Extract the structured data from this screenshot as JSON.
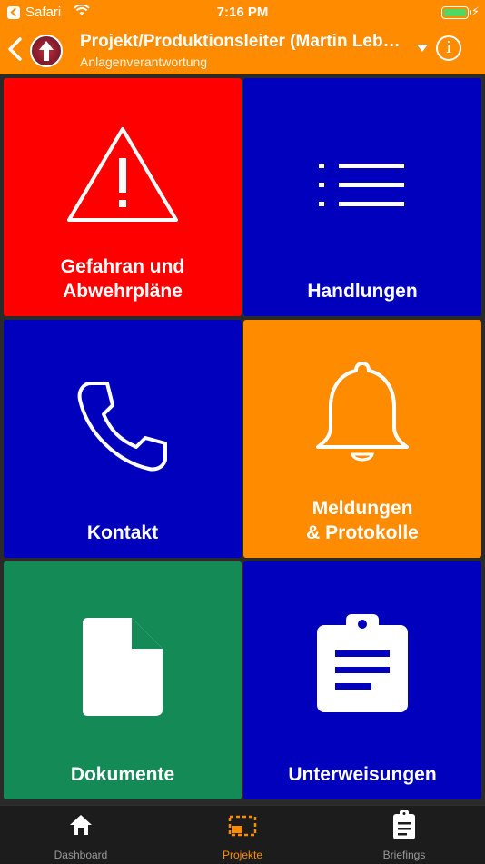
{
  "status_bar": {
    "back_app": "Safari",
    "time": "7:16 PM"
  },
  "nav": {
    "title": "Projekt/Produktionsleiter (Martin Leb…",
    "subtitle": "Anlagenverantwortung",
    "info_glyph": "i"
  },
  "tiles": [
    {
      "label": "Gefahran und\nAbwehrpläne",
      "icon": "warning-icon",
      "color": "#ff0000"
    },
    {
      "label": "Handlungen",
      "icon": "list-icon",
      "color": "#0000bd"
    },
    {
      "label": "Kontakt",
      "icon": "phone-icon",
      "color": "#0000bd"
    },
    {
      "label": "Meldungen\n& Protokolle",
      "icon": "bell-icon",
      "color": "#ff8c00"
    },
    {
      "label": "Dokumente",
      "icon": "document-icon",
      "color": "#148a57"
    },
    {
      "label": "Unterweisungen",
      "icon": "clipboard-icon",
      "color": "#0000bd"
    }
  ],
  "tabs": [
    {
      "label": "Dashboard",
      "icon": "home-icon",
      "active": false
    },
    {
      "label": "Projekte",
      "icon": "projects-icon",
      "active": true
    },
    {
      "label": "Briefings",
      "icon": "clipboard-icon",
      "active": false
    }
  ],
  "colors": {
    "accent": "#ff8c00",
    "tab_inactive": "#9a9a9a"
  }
}
